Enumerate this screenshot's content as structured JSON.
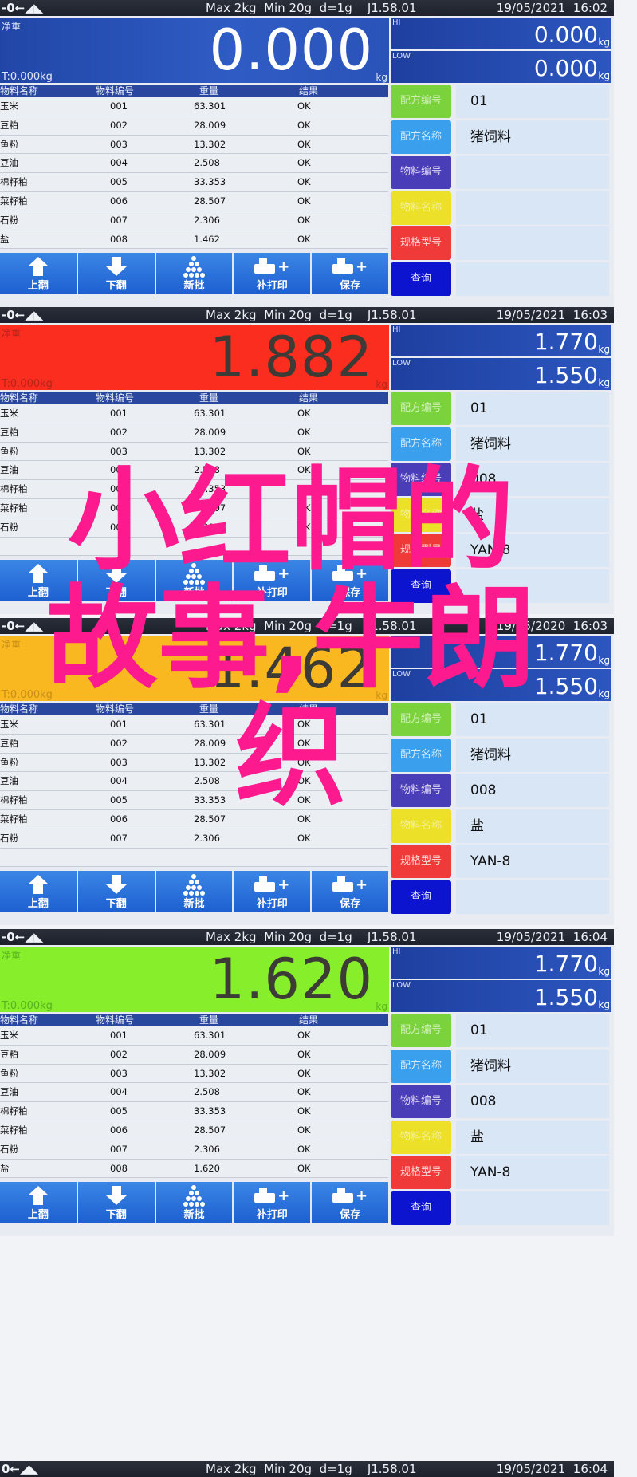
{
  "overlay_title": "小红帽的故事,牛朗织",
  "common": {
    "zero_indicator": "-0←◢◣",
    "scale_spec": "Max 2kg  Min 20g  d=1g    J1.58.01",
    "net_label": "净重",
    "tare_label": "T:0.000kg",
    "unit": "kg",
    "hi_label": "HI",
    "low_label": "LOW",
    "table_headers": [
      "物料名称",
      "物料编号",
      "重量",
      "结果"
    ],
    "buttons": [
      "上翻",
      "下翻",
      "新批",
      "补打印",
      "保存"
    ],
    "side_buttons": [
      "配方编号",
      "配方名称",
      "物料编号",
      "物料名称",
      "规格型号",
      "查询"
    ]
  },
  "panels": [
    {
      "datetime": "19/05/2021  16:02",
      "display_state": "idle",
      "weight": "0.000",
      "hi": "0.000",
      "low": "0.000",
      "rows": [
        [
          "玉米",
          "001",
          "63.301",
          "OK"
        ],
        [
          "豆粕",
          "002",
          "28.009",
          "OK"
        ],
        [
          "鱼粉",
          "003",
          "13.302",
          "OK"
        ],
        [
          "豆油",
          "004",
          "2.508",
          "OK"
        ],
        [
          "棉籽粕",
          "005",
          "33.353",
          "OK"
        ],
        [
          "菜籽粕",
          "006",
          "28.507",
          "OK"
        ],
        [
          "石粉",
          "007",
          "2.306",
          "OK"
        ],
        [
          "盐",
          "008",
          "1.462",
          "OK"
        ]
      ],
      "info": [
        "01",
        "猪饲料",
        "",
        "",
        "",
        ""
      ]
    },
    {
      "datetime": "19/05/2021  16:03",
      "display_state": "over",
      "weight": "1.882",
      "hi": "1.770",
      "low": "1.550",
      "rows": [
        [
          "玉米",
          "001",
          "63.301",
          "OK"
        ],
        [
          "豆粕",
          "002",
          "28.009",
          "OK"
        ],
        [
          "鱼粉",
          "003",
          "13.302",
          "OK"
        ],
        [
          "豆油",
          "004",
          "2.508",
          "OK"
        ],
        [
          "棉籽粕",
          "005",
          "33.353",
          "OK"
        ],
        [
          "菜籽粕",
          "006",
          "28.507",
          "OK"
        ],
        [
          "石粉",
          "007",
          "2.306",
          "OK"
        ],
        [
          "",
          "",
          "",
          ""
        ]
      ],
      "info": [
        "01",
        "猪饲料",
        "008",
        "盐",
        "YAN-8",
        ""
      ]
    },
    {
      "datetime": "19/05/2020  16:03",
      "display_state": "under",
      "weight": "1.462",
      "hi": "1.770",
      "low": "1.550",
      "rows": [
        [
          "玉米",
          "001",
          "63.301",
          "OK"
        ],
        [
          "豆粕",
          "002",
          "28.009",
          "OK"
        ],
        [
          "鱼粉",
          "003",
          "13.302",
          "OK"
        ],
        [
          "豆油",
          "004",
          "2.508",
          "OK"
        ],
        [
          "棉籽粕",
          "005",
          "33.353",
          "OK"
        ],
        [
          "菜籽粕",
          "006",
          "28.507",
          "OK"
        ],
        [
          "石粉",
          "007",
          "2.306",
          "OK"
        ],
        [
          "",
          "",
          "",
          ""
        ]
      ],
      "info": [
        "01",
        "猪饲料",
        "008",
        "盐",
        "YAN-8",
        ""
      ]
    },
    {
      "datetime": "19/05/2021  16:04",
      "display_state": "ok",
      "weight": "1.620",
      "hi": "1.770",
      "low": "1.550",
      "rows": [
        [
          "玉米",
          "001",
          "63.301",
          "OK"
        ],
        [
          "豆粕",
          "002",
          "28.009",
          "OK"
        ],
        [
          "鱼粉",
          "003",
          "13.302",
          "OK"
        ],
        [
          "豆油",
          "004",
          "2.508",
          "OK"
        ],
        [
          "棉籽粕",
          "005",
          "33.353",
          "OK"
        ],
        [
          "菜籽粕",
          "006",
          "28.507",
          "OK"
        ],
        [
          "石粉",
          "007",
          "2.306",
          "OK"
        ],
        [
          "盐",
          "008",
          "1.620",
          "OK"
        ]
      ],
      "info": [
        "01",
        "猪饲料",
        "008",
        "盐",
        "YAN-8",
        ""
      ]
    }
  ],
  "footer_bar": {
    "zero_indicator": "0←◢◣",
    "scale_spec": "Max 2kg  Min 20g  d=1g    J1.58.01",
    "datetime": "19/05/2021  16:04"
  },
  "colors": {
    "idle_display": "#2a53b8",
    "over_display": "#fb2d1f",
    "under_display": "#f9b81f",
    "ok_display": "#86ee2b",
    "overlay_text": "#fd1a8e"
  }
}
